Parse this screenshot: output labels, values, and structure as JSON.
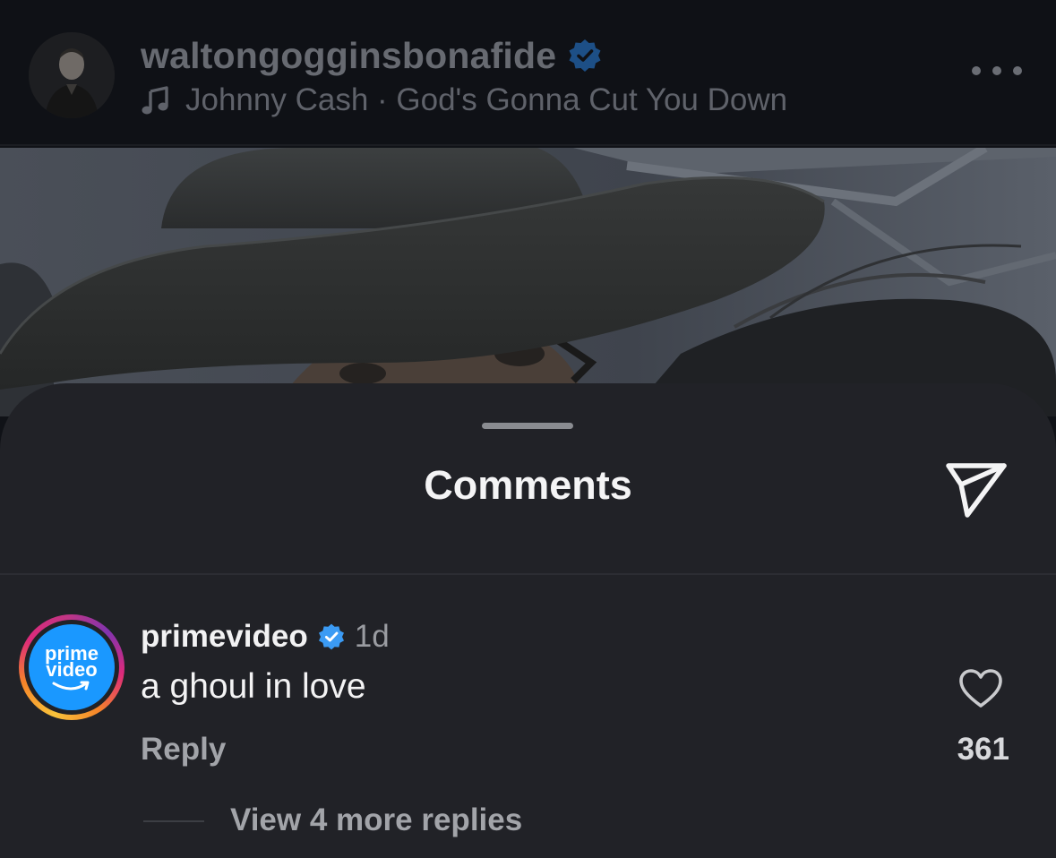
{
  "post_header": {
    "username": "waltongogginsbonafide",
    "verified": true,
    "track": "Johnny Cash · God's Gonna Cut You Down",
    "avatar_icon": "user-avatar-photo",
    "music_icon": "music-note-icon",
    "more_icon": "more-options-icon"
  },
  "post_media": {
    "description_icon": "post-image"
  },
  "comments_sheet": {
    "title": "Comments",
    "share_icon": "send-icon"
  },
  "comments": [
    {
      "username": "primevideo",
      "verified": true,
      "time": "1d",
      "text": "a ghoul in love",
      "reply_label": "Reply",
      "like_count": "361",
      "view_replies_label": "View 4 more replies",
      "avatar_brand_line1": "prime",
      "avatar_brand_line2": "video"
    }
  ],
  "colors": {
    "verified_blue": "#3b9bf4",
    "sheet_background": "#212227",
    "brand_blue": "#1a98ff"
  }
}
